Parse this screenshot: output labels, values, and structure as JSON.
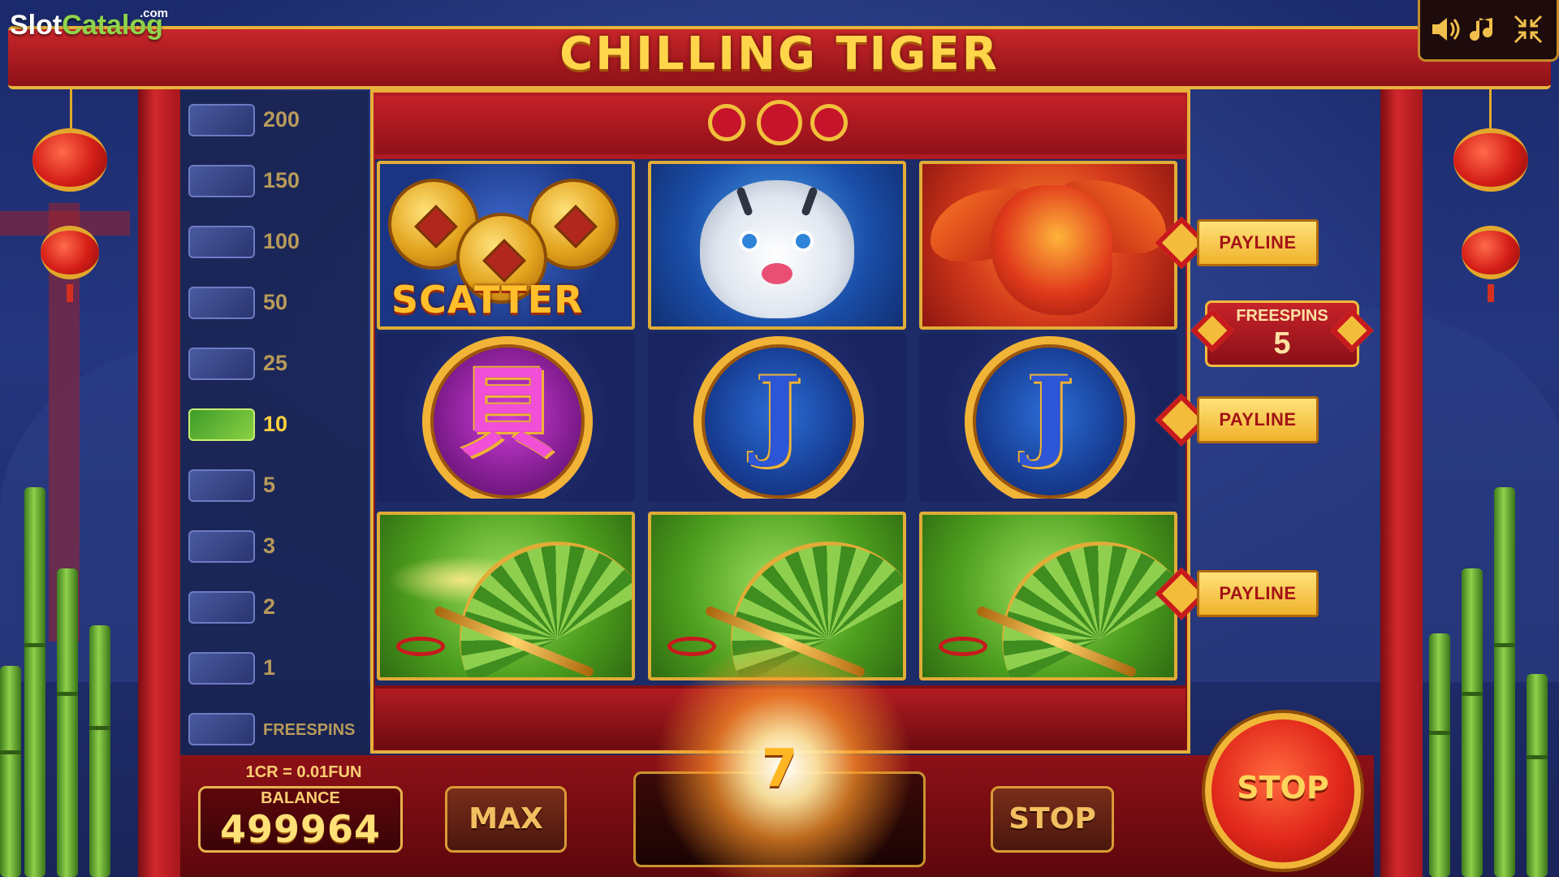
{
  "app": {
    "watermark": "SlotCatalog",
    "watermark_suffix": ".com",
    "watermark_part1": "Slot",
    "watermark_part2": "Catalog",
    "title": "CHILLING TIGER"
  },
  "controls": {
    "sound_icon": "speaker-icon",
    "music_icon": "music-note-icon",
    "fullscreen_icon": "exit-fullscreen-icon"
  },
  "paytable": [
    {
      "symbol": "wild",
      "value": "200"
    },
    {
      "symbol": "phoenix",
      "value": "150"
    },
    {
      "symbol": "tiger",
      "value": "100"
    },
    {
      "symbol": "koi",
      "value": "50"
    },
    {
      "symbol": "yin-yang",
      "value": "25"
    },
    {
      "symbol": "fan",
      "value": "10"
    },
    {
      "symbol": "glyph-a",
      "value": "5"
    },
    {
      "symbol": "glyph-b",
      "value": "3"
    },
    {
      "symbol": "glyph-c",
      "value": "2"
    },
    {
      "symbol": "glyph-d",
      "value": "1"
    },
    {
      "symbol": "scatter",
      "value": "FREESPINS"
    }
  ],
  "paytable_active_index": 5,
  "reels": {
    "row1": [
      "scatter",
      "tiger",
      "phoenix"
    ],
    "row2": [
      "glyph-pink",
      "glyph-blue",
      "glyph-blue"
    ],
    "row3": [
      "fan",
      "fan",
      "fan"
    ],
    "scatter_label": "SCATTER",
    "glyph_pink": "貝",
    "glyph_blue": "J"
  },
  "paylines": {
    "label": "PAYLINE",
    "freespins_label": "FREESPINS",
    "freespins_count": "5"
  },
  "bottom": {
    "rate": "1CR = 0.01FUN",
    "balance_label": "BALANCE",
    "balance": "499964",
    "max_label": "MAX",
    "win": "7",
    "stop_label": "STOP",
    "stop_round_label": "STOP"
  },
  "colors": {
    "frame_red": "#c8262a",
    "gold": "#e8b33a",
    "highlight_green": "#89d043"
  }
}
